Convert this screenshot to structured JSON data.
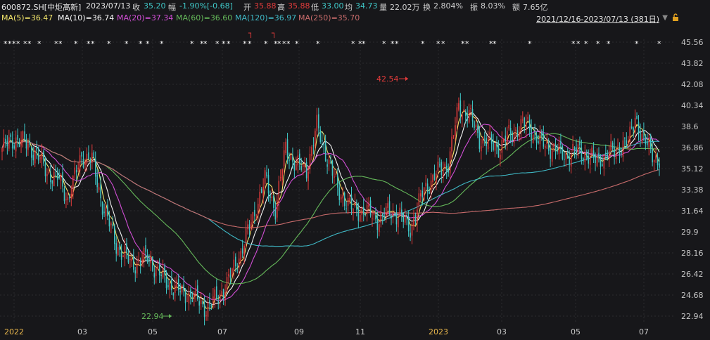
{
  "header": {
    "code": "600872.SH[中炬高新]",
    "date": "2023/07/13",
    "close_label": "收",
    "close": "35.20",
    "change_label": "幅",
    "change": "-1.90%[-0.68]",
    "open_label": "开",
    "open": "35.88",
    "high_label": "高",
    "high": "35.88",
    "low_label": "低",
    "low": "33.00",
    "avg_label": "均",
    "avg": "34.73",
    "volume_label": "量",
    "volume": "22.02万",
    "turnover_label": "换",
    "turnover": "2.804%",
    "amplitude_label": "振",
    "amplitude": "8.03%",
    "amount_label": "额",
    "amount": "7.65亿"
  },
  "ma_legend": [
    {
      "label": "MA(5)=36.47",
      "color": "#f0e36a"
    },
    {
      "label": "MA(10)=36.74",
      "color": "#f5f5f5"
    },
    {
      "label": "MA(20)=37.34",
      "color": "#d24fd6"
    },
    {
      "label": "MA(60)=36.60",
      "color": "#65b85a"
    },
    {
      "label": "MA(120)=36.97",
      "color": "#3fb7c4"
    },
    {
      "label": "MA(250)=35.70",
      "color": "#c86b6b"
    }
  ],
  "range_text": "2021/12/16-2023/07/13 (381日)",
  "icons": {
    "dropdown": "triangle-down-icon",
    "lock": "lock-icon"
  },
  "colors": {
    "up": "#e23b3b",
    "down": "#3fc6c6",
    "bg": "#17171a",
    "grid": "#2b2b2f"
  },
  "chart_data": {
    "type": "candlestick",
    "x_tick_labels": [
      "2022",
      "03",
      "05",
      "07",
      "09",
      "11",
      "2023",
      "03",
      "05",
      "07"
    ],
    "y_tick_labels": [
      "45.56",
      "43.82",
      "42.08",
      "40.34",
      "38.6",
      "36.86",
      "35.12",
      "33.38",
      "31.64",
      "29.9",
      "28.16",
      "26.42",
      "24.68",
      "22.94"
    ],
    "ylim": [
      22.94,
      45.56
    ],
    "annotations": [
      {
        "text": "42.54",
        "value": 42.54,
        "kind": "high"
      },
      {
        "text": "22.94",
        "value": 22.94,
        "kind": "low"
      }
    ],
    "price_path": [
      [
        0,
        36.8
      ],
      [
        8,
        37.6
      ],
      [
        15,
        37.0
      ],
      [
        20,
        36.3
      ],
      [
        26,
        34.8
      ],
      [
        33,
        34.2
      ],
      [
        38,
        32.6
      ],
      [
        46,
        36.2
      ],
      [
        52,
        35.8
      ],
      [
        58,
        32.2
      ],
      [
        66,
        28.8
      ],
      [
        75,
        27.2
      ],
      [
        84,
        27.8
      ],
      [
        92,
        26.2
      ],
      [
        102,
        25.0
      ],
      [
        110,
        24.6
      ],
      [
        118,
        23.6
      ],
      [
        124,
        24.4
      ],
      [
        130,
        25.6
      ],
      [
        138,
        28.2
      ],
      [
        146,
        31.5
      ],
      [
        152,
        34.2
      ],
      [
        158,
        31.8
      ],
      [
        164,
        36.8
      ],
      [
        170,
        35.4
      ],
      [
        176,
        35.0
      ],
      [
        182,
        38.6
      ],
      [
        188,
        36.0
      ],
      [
        194,
        33.4
      ],
      [
        202,
        31.8
      ],
      [
        210,
        31.6
      ],
      [
        218,
        30.9
      ],
      [
        224,
        31.6
      ],
      [
        230,
        31.2
      ],
      [
        236,
        30.2
      ],
      [
        244,
        33.4
      ],
      [
        252,
        34.8
      ],
      [
        258,
        35.6
      ],
      [
        264,
        40.2
      ],
      [
        270,
        39.6
      ],
      [
        276,
        37.6
      ],
      [
        282,
        37.2
      ],
      [
        288,
        36.8
      ],
      [
        292,
        37.8
      ],
      [
        298,
        38.4
      ],
      [
        304,
        38.8
      ],
      [
        310,
        37.4
      ],
      [
        318,
        36.8
      ],
      [
        326,
        36.2
      ],
      [
        334,
        36.6
      ],
      [
        342,
        35.8
      ],
      [
        350,
        36.2
      ],
      [
        356,
        36.9
      ],
      [
        362,
        37.2
      ],
      [
        366,
        39.6
      ],
      [
        370,
        37.4
      ],
      [
        375,
        36.9
      ],
      [
        380,
        35.2
      ]
    ],
    "ma_series": [
      {
        "name": "MA(5)",
        "color": "#f0e36a",
        "period": 5
      },
      {
        "name": "MA(10)",
        "color": "#f5f5f5",
        "period": 10
      },
      {
        "name": "MA(20)",
        "color": "#d24fd6",
        "period": 20
      },
      {
        "name": "MA(60)",
        "color": "#65b85a",
        "period": 60
      },
      {
        "name": "MA(120)",
        "color": "#3fb7c4",
        "period": 120
      },
      {
        "name": "MA(250)",
        "color": "#c86b6b",
        "period": 250
      }
    ],
    "star_markers_count": 52,
    "arrow_markers": [
      "┐",
      "┐"
    ],
    "grid": true
  }
}
